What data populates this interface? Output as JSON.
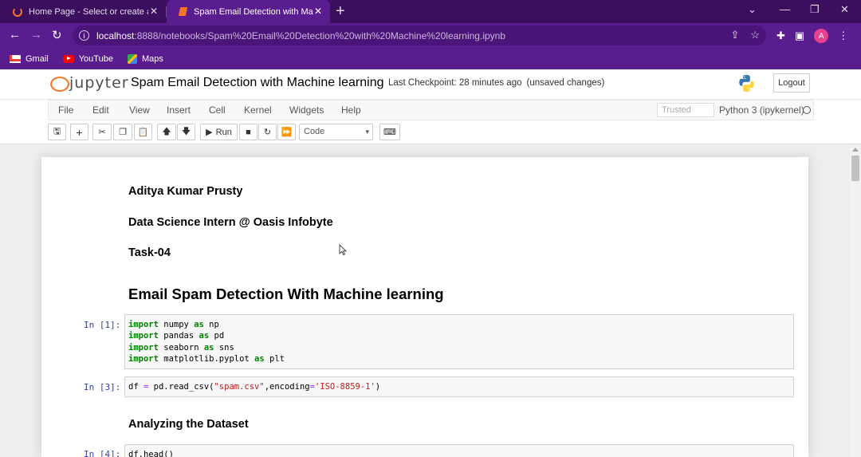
{
  "browser": {
    "tabs": [
      {
        "title": "Home Page - Select or create a n",
        "active": false
      },
      {
        "title": "Spam Email Detection with Mach",
        "active": true
      }
    ],
    "url_host": "localhost",
    "url_path": ":8888/notebooks/Spam%20Email%20Detection%20with%20Machine%20learning.ipynb",
    "profile_initial": "A",
    "bookmarks": [
      "Gmail",
      "YouTube",
      "Maps"
    ]
  },
  "jupyter": {
    "wordmark": "jupyter",
    "notebook_title": "Spam Email Detection with Machine learning",
    "checkpoint": "Last Checkpoint: 28 minutes ago",
    "unsaved": "(unsaved changes)",
    "logout_label": "Logout",
    "menu": [
      "File",
      "Edit",
      "View",
      "Insert",
      "Cell",
      "Kernel",
      "Widgets",
      "Help"
    ],
    "trusted_label": "Trusted",
    "kernel_name": "Python 3 (ipykernel)",
    "run_label": "Run",
    "cell_type": "Code"
  },
  "notebook": {
    "md1": "Aditya Kumar Prusty",
    "md2": "Data Science Intern @ Oasis Infobyte",
    "md3": "Task-04",
    "md4": "Email Spam Detection With Machine learning",
    "md5": "Analyzing the Dataset",
    "cell1_prompt": "In [1]:",
    "cell2_prompt": "In [3]:",
    "cell3_prompt": "In [4]:",
    "cell3_code": "df.head()"
  },
  "colors": {
    "browser_frame": "#3b0f5e",
    "browser_toolbar": "#5a1d8f",
    "jupyter_orange": "#f37726",
    "prompt_blue": "#303f9f"
  }
}
